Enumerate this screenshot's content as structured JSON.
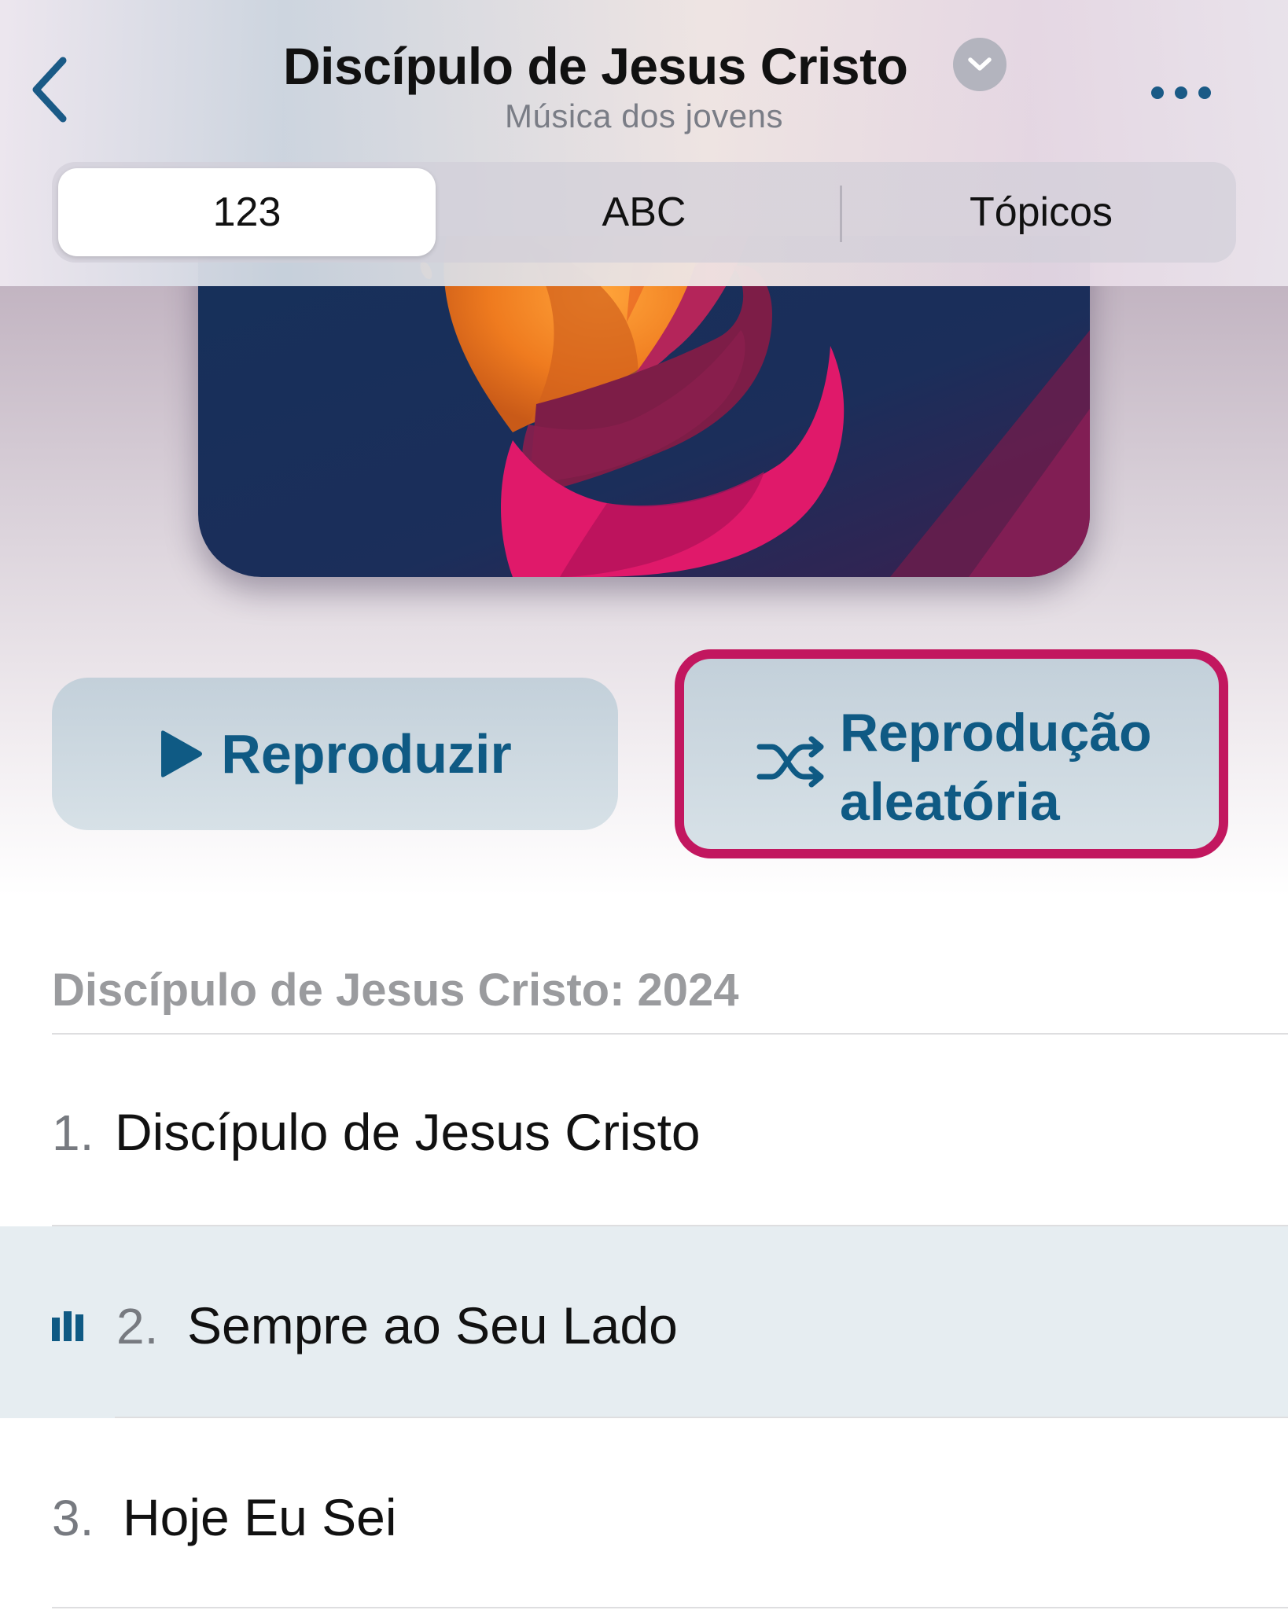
{
  "header": {
    "title": "Discípulo de Jesus Cristo",
    "subtitle": "Música dos jovens",
    "back_icon": "chevron-left-icon",
    "title_menu_icon": "chevron-down-icon",
    "more_icon": "ellipsis-icon"
  },
  "tabs": [
    {
      "label": "123",
      "selected": true
    },
    {
      "label": "ABC",
      "selected": false
    },
    {
      "label": "Tópicos",
      "selected": false
    }
  ],
  "actions": {
    "play_label": "Reproduzir",
    "shuffle_line1": "Reprodução",
    "shuffle_line2": "aleatória"
  },
  "section": {
    "title": "Discípulo de Jesus Cristo: 2024"
  },
  "tracks": [
    {
      "number": "1.",
      "title": "Discípulo de Jesus Cristo",
      "playing": false
    },
    {
      "number": "2.",
      "title": "Sempre ao Seu Lado",
      "playing": true
    },
    {
      "number": "3.",
      "title": "Hoje Eu Sei",
      "playing": false
    }
  ],
  "colors": {
    "accent": "#0f5a84",
    "highlight_border": "#c2175f",
    "playing_row_bg": "#e6edf1"
  }
}
